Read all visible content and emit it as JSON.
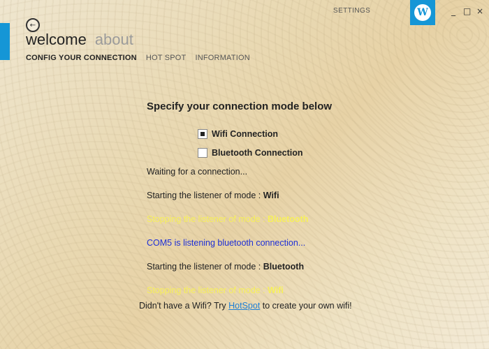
{
  "window": {
    "settings_label": "SETTINGS",
    "controls": {
      "minimize": "_",
      "maximize": "□",
      "close": "×"
    },
    "logo_letter": "W"
  },
  "header": {
    "back_icon": "arrow-left",
    "title": "welcome",
    "subtitle": "about",
    "tabs": [
      {
        "label": "CONFIG YOUR CONNECTION",
        "active": true
      },
      {
        "label": "HOT SPOT",
        "active": false
      },
      {
        "label": "INFORMATION",
        "active": false
      }
    ]
  },
  "main": {
    "heading": "Specify your connection mode below",
    "options": [
      {
        "label": "Wifi Connection",
        "checked": true
      },
      {
        "label": "Bluetooth Connection",
        "checked": false
      }
    ],
    "log": [
      {
        "text": "Waiting for a connection...",
        "bold": "",
        "color": "default"
      },
      {
        "text": "Starting the listener of mode : ",
        "bold": "Wifi",
        "color": "default"
      },
      {
        "text": "Stopping the listener of mode : ",
        "bold": "Bluetooth",
        "color": "yellow"
      },
      {
        "text": "COM5 is listening bluetooth connection...",
        "bold": "",
        "color": "blue"
      },
      {
        "text": "Starting the listener of mode : ",
        "bold": "Bluetooth",
        "color": "default"
      },
      {
        "text": "Stopping the listener of mode : ",
        "bold": "Wifi",
        "color": "yellow"
      }
    ]
  },
  "footer": {
    "prefix": "Didn't have a Wifi? Try ",
    "link": "HotSpot",
    "suffix": " to create your own wifi!"
  },
  "colors": {
    "accent": "#1596d6",
    "log_yellow": "#f7f05a",
    "log_blue": "#1e2fd6",
    "link": "#1e7fd6"
  }
}
